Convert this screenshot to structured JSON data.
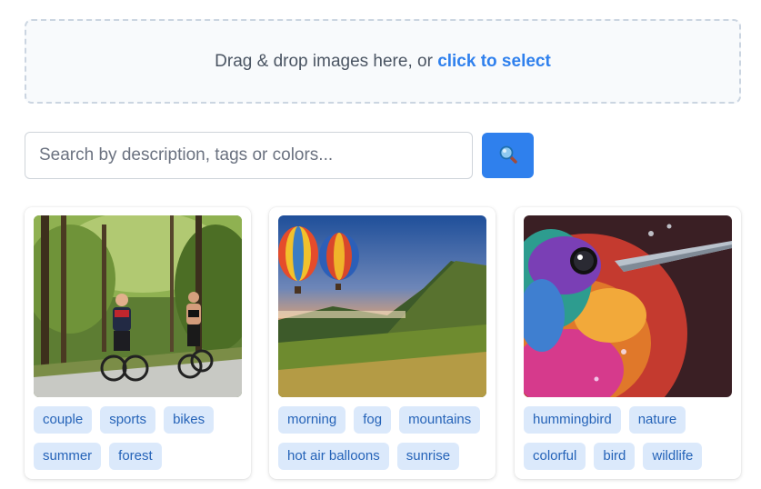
{
  "upload": {
    "prompt_text": "Drag & drop images here, or ",
    "link_text": "click to select"
  },
  "search": {
    "placeholder": "Search by description, tags or colors...",
    "value": "",
    "button_icon": "magnifier-icon"
  },
  "colors": {
    "accent": "#2f80ed",
    "tag_bg": "#dbe9fb",
    "tag_text": "#2563b8"
  },
  "cards": [
    {
      "image": "couple cycling on a forest road",
      "tags": [
        "couple",
        "sports",
        "bikes",
        "summer",
        "forest"
      ]
    },
    {
      "image": "hot air balloons over misty mountains at sunrise",
      "tags": [
        "morning",
        "fog",
        "mountains",
        "hot air balloons",
        "sunrise"
      ]
    },
    {
      "image": "close-up of a colorful hummingbird",
      "tags": [
        "hummingbird",
        "nature",
        "colorful",
        "bird",
        "wildlife"
      ]
    }
  ]
}
